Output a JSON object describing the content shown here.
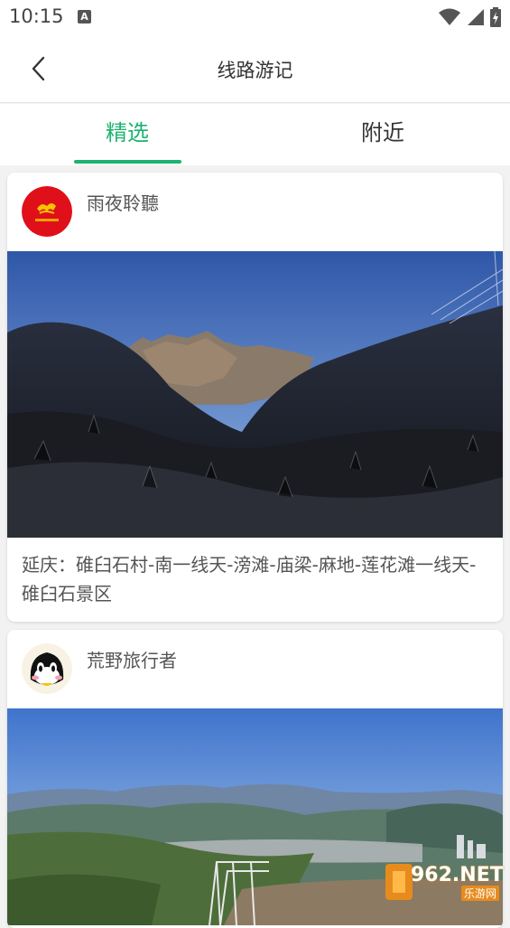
{
  "status_bar": {
    "time": "10:15",
    "notification_badge": "A",
    "icons": [
      "wifi-icon",
      "signal-icon",
      "battery-icon"
    ]
  },
  "header": {
    "title": "线路游记",
    "back_icon": "chevron-left-icon"
  },
  "tabs": [
    {
      "label": "精选",
      "active": true
    },
    {
      "label": "附近",
      "active": false
    }
  ],
  "colors": {
    "accent": "#1db370",
    "text_primary": "#333333",
    "text_secondary": "#555555"
  },
  "posts": [
    {
      "author": "雨夜聆聽",
      "title": "延庆：碓臼石村-南一线天-滂滩-庙梁-麻地-莲花滩一线天-碓臼石景区"
    },
    {
      "author": "荒野旅行者",
      "title": ""
    }
  ],
  "watermark": {
    "brand": "962.NET",
    "sub": "乐游网"
  }
}
